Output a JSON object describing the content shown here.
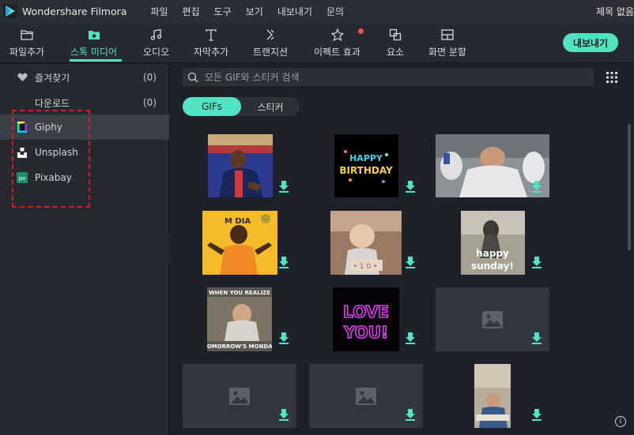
{
  "titlebar": {
    "app_name": "Wondershare Filmora",
    "menus": [
      "파일",
      "편집",
      "도구",
      "보기",
      "내보내기",
      "문의"
    ],
    "window_title": "제목 없음"
  },
  "toolbar": {
    "tools": [
      {
        "label": "파일추가",
        "icon": "folder-icon"
      },
      {
        "label": "스톡 미디어",
        "icon": "stock-media-folder-icon",
        "active": true
      },
      {
        "label": "오디오",
        "icon": "music-note-icon"
      },
      {
        "label": "자막추가",
        "icon": "text-T-icon"
      },
      {
        "label": "트랜지션",
        "icon": "transition-icon"
      },
      {
        "label": "이펙트 효과",
        "icon": "effects-icon",
        "notification": true
      },
      {
        "label": "요소",
        "icon": "elements-icon"
      },
      {
        "label": "화면 분할",
        "icon": "split-screen-icon"
      }
    ],
    "export_label": "내보내기"
  },
  "sidebar": {
    "items": [
      {
        "label": "즐겨찾기",
        "count": "(0)",
        "icon": "heart-icon"
      },
      {
        "label": "다운로드",
        "count": "(0)",
        "icon": ""
      },
      {
        "label": "Giphy",
        "icon": "giphy-icon",
        "selected": true
      },
      {
        "label": "Unsplash",
        "icon": "unsplash-icon"
      },
      {
        "label": "Pixabay",
        "icon": "pixabay-icon"
      }
    ]
  },
  "search": {
    "placeholder": "모든 GIF와 스티커 검색"
  },
  "tabs": [
    {
      "label": "GIFs",
      "active": true
    },
    {
      "label": "스티커"
    }
  ],
  "media": [
    {
      "name": "soccer-player-gif",
      "kind": "image"
    },
    {
      "name": "happy-birthday-gif",
      "kind": "image"
    },
    {
      "name": "laughing-players-gif",
      "kind": "image"
    },
    {
      "name": "dancing-woman-gif",
      "kind": "image"
    },
    {
      "name": "laughing-baby-gif",
      "kind": "image"
    },
    {
      "name": "happy-sunday-gif",
      "kind": "image"
    },
    {
      "name": "tomorrow-monday-meme-gif",
      "kind": "image"
    },
    {
      "name": "love-you-gif",
      "kind": "image"
    },
    {
      "name": "loading-placeholder",
      "kind": "placeholder"
    },
    {
      "name": "loading-placeholder",
      "kind": "placeholder"
    },
    {
      "name": "loading-placeholder",
      "kind": "placeholder"
    },
    {
      "name": "sleeping-man-gif",
      "kind": "image"
    }
  ],
  "colors": {
    "accent": "#52e3c2",
    "background": "#1e2129",
    "panel": "#262930",
    "highlight_box": "#d31f1f",
    "notification_dot": "#f0524a"
  }
}
